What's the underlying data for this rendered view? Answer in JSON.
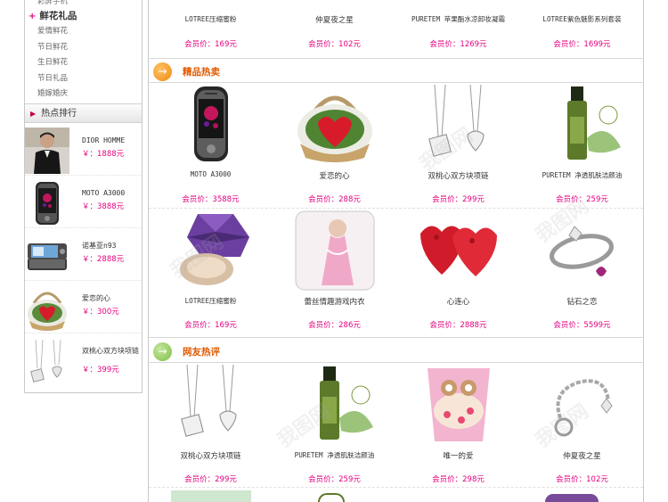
{
  "sidebar": {
    "top_item": "彩屏手机",
    "category": {
      "title": "鲜花礼品",
      "items": [
        "爱情鲜花",
        "节日鲜花",
        "生日鲜花",
        "节日礼品",
        "婚嫁婚庆"
      ]
    },
    "hot_title": "热点排行",
    "hot": [
      {
        "name": "DIOR HOMME",
        "price": "￥：1888元",
        "icon": "man-photo-icon"
      },
      {
        "name": "MOTO A3000",
        "price": "￥：3888元",
        "icon": "phone-icon"
      },
      {
        "name": "诺基亚n93",
        "price": "￥：2888元",
        "icon": "nokia-phone-icon"
      },
      {
        "name": "爱恋的心",
        "price": "￥：300元",
        "icon": "flower-basket-icon"
      },
      {
        "name": "双桃心双方块项链",
        "price": "￥：399元",
        "icon": "necklace-icon"
      }
    ]
  },
  "top_row": [
    {
      "name": "LOTREE压缩蜜粉",
      "price": "会员价：169元"
    },
    {
      "name": "仲夏夜之星",
      "price": "会员价：102元"
    },
    {
      "name": "PURETEM 苹果酯水凉卸妆凝霜",
      "price": "会员价：1269元"
    },
    {
      "name": "LOTREE紫色魅影系列套装",
      "price": "会员价：1699元"
    }
  ],
  "section1": {
    "title": "精品热卖",
    "rows": [
      [
        {
          "name": "MOTO A3000",
          "price": "会员价：3588元",
          "icon": "phone-icon"
        },
        {
          "name": "爱恋的心",
          "price": "会员价：288元",
          "icon": "flower-basket-icon"
        },
        {
          "name": "双桃心双方块项链",
          "price": "会员价：299元",
          "icon": "necklace-icon"
        },
        {
          "name": "PURETEM 净透肌肤洁颜油",
          "price": "会员价：259元",
          "icon": "bottle-icon"
        }
      ],
      [
        {
          "name": "LOTREE压缩蜜粉",
          "price": "会员价：169元",
          "icon": "powder-compact-icon"
        },
        {
          "name": "蕾丝情趣游戏内衣",
          "price": "会员价：286元",
          "icon": "lingerie-icon"
        },
        {
          "name": "心连心",
          "price": "会员价：2888元",
          "icon": "rose-hearts-icon"
        },
        {
          "name": "钻石之恋",
          "price": "会员价：5599元",
          "icon": "ring-icon"
        }
      ]
    ]
  },
  "section2": {
    "title": "网友热评",
    "rows": [
      [
        {
          "name": "双桃心双方块项链",
          "price": "会员价：299元",
          "icon": "necklace-icon"
        },
        {
          "name": "PURETEM 净透肌肤洁颜油",
          "price": "会员价：259元",
          "icon": "bottle-icon"
        },
        {
          "name": "唯一的爱",
          "price": "会员价：298元",
          "icon": "bouquet-icon"
        },
        {
          "name": "仲夏夜之星",
          "price": "会员价：102元",
          "icon": "bracelet-icon"
        }
      ]
    ]
  },
  "watermark": "我图网"
}
